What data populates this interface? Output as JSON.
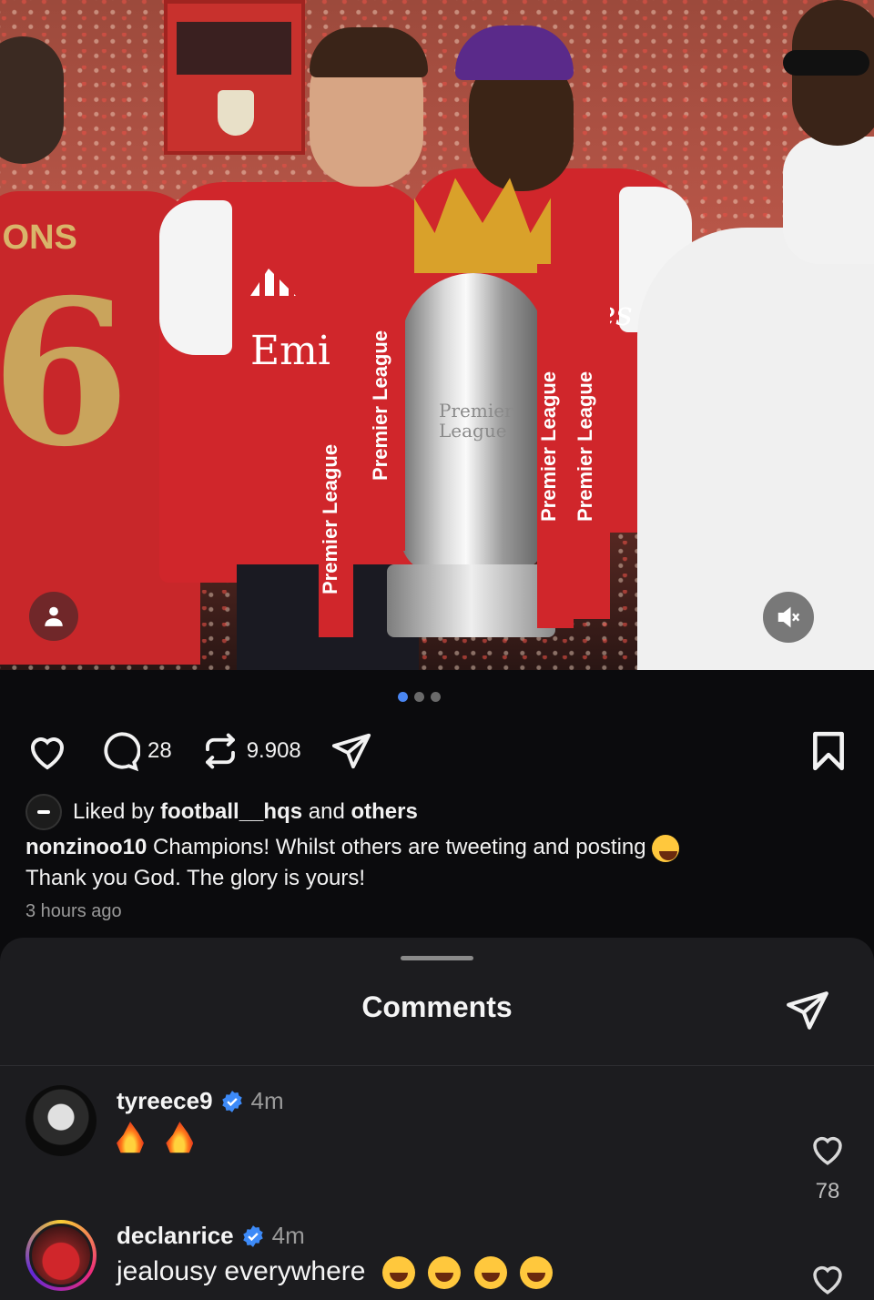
{
  "post": {
    "image_alt": "",
    "jersey_number": "6",
    "jersey_name": "IONS",
    "sponsor_text": "Emi",
    "sponsor_text_2": "es",
    "trophy_text": "Premier League",
    "ribbon_text": "Premier League",
    "carousel": {
      "count": 3,
      "active_index": 0
    },
    "stats": {
      "comments": "28",
      "reposts": "9.908"
    },
    "liked_by": {
      "prefix": "Liked by",
      "user": "football__hqs",
      "connector": "and",
      "suffix": "others"
    },
    "caption": {
      "username": "nonzinoo10",
      "text": "Champions! Whilst others are tweeting and posting",
      "text_line2": "Thank you God. The glory is yours!"
    },
    "time_ago": "3 hours ago"
  },
  "comments_sheet": {
    "title": "Comments",
    "comments": [
      {
        "username": "tyreece9",
        "verified": true,
        "time": "4m",
        "emojis": [
          "fire",
          "fire"
        ],
        "likes": "78"
      },
      {
        "username": "declanrice",
        "verified": true,
        "time": "4m",
        "text": "jealousy everywhere",
        "emojis": [
          "rolling-laughing",
          "rolling-laughing",
          "rolling-laughing",
          "rolling-laughing"
        ]
      }
    ]
  },
  "colors": {
    "background": "#0b0b0d",
    "sheet": "#1c1c1f",
    "accent_blue": "#4a86f2",
    "verified_blue": "#3d8af7",
    "arsenal_red": "#d0262b"
  }
}
